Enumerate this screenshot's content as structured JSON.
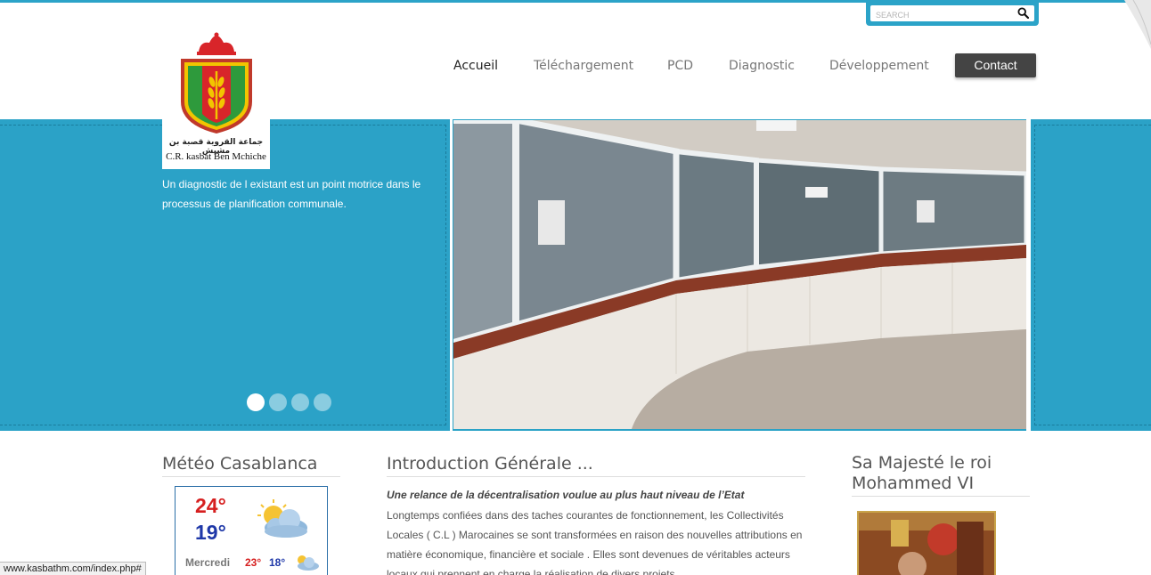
{
  "search": {
    "placeholder": "SEARCH"
  },
  "logo": {
    "arabic_text": "جماعة القروية قصبة بن مشيش",
    "latin_text": "C.R. kasbat Ben Mchiche"
  },
  "nav": {
    "items": [
      {
        "label": "Accueil",
        "active": true
      },
      {
        "label": "Téléchargement",
        "active": false
      },
      {
        "label": "PCD",
        "active": false
      },
      {
        "label": "Diagnostic",
        "active": false
      },
      {
        "label": "Développement",
        "active": false
      }
    ],
    "contact_label": "Contact"
  },
  "hero": {
    "caption": "Un diagnostic de l existant est un point motrice dans le processus de planification communale.",
    "slide_count": 4,
    "active_slide": 1
  },
  "weather": {
    "title": "Météo Casablanca",
    "current_high": "24°",
    "current_low": "19°",
    "day_label": "Mercredi",
    "day_high": "23°",
    "day_low": "18°",
    "icon": "partly-cloudy-icon"
  },
  "intro": {
    "title": "Introduction Générale ...",
    "subtitle": "Une relance de la décentralisation voulue au plus haut niveau de l’Etat",
    "body": "Longtemps confiées dans des taches  courantes de fonctionnement, les Collectivités Locales ( C.L ) Marocaines se sont transformées en raison des nouvelles attributions en matière économique, financière et sociale . Elles sont devenues de véritables acteurs locaux qui prennent en charge la réalisation de divers projets"
  },
  "king": {
    "title": "Sa Majesté le roi Mohammed VI"
  },
  "status_bar": {
    "url": "www.kasbathm.com/index.php#"
  },
  "colors": {
    "accent": "#2ba2c7",
    "contact_button": "#444444",
    "temp_high": "#d61f1f",
    "temp_low": "#1f38a8"
  }
}
